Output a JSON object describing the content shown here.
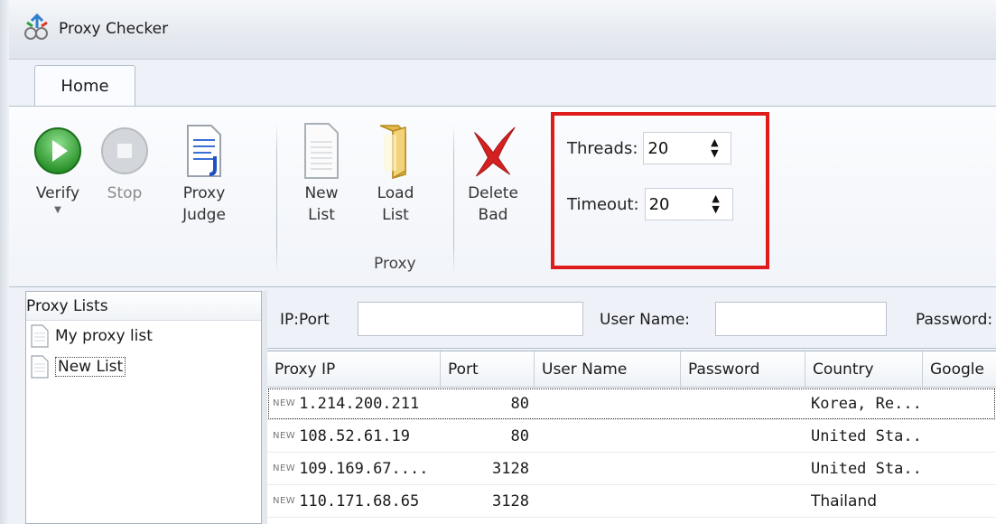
{
  "window": {
    "title": "Proxy Checker"
  },
  "ribbon": {
    "tab": "Home",
    "buttons": {
      "verify": "Verify",
      "stop": "Stop",
      "proxy_judge": "Proxy\nJudge",
      "new_list": "New\nList",
      "load_list": "Load\nList",
      "delete_bad": "Delete\nBad"
    },
    "group_proxy": "Proxy",
    "threads": {
      "label": "Threads:",
      "value": "20"
    },
    "timeout": {
      "label": "Timeout:",
      "value": "20"
    }
  },
  "proxy_lists": {
    "header": "Proxy Lists",
    "items": [
      {
        "name": "My proxy list",
        "selected": false
      },
      {
        "name": "New List",
        "selected": true
      }
    ]
  },
  "filter": {
    "ip_port_label": "IP:Port",
    "ip_port_value": "",
    "username_label": "User Name:",
    "username_value": "",
    "password_label": "Password:"
  },
  "grid": {
    "columns": [
      "Proxy IP",
      "Port",
      "User Name",
      "Password",
      "Country",
      "Google"
    ],
    "new_tag": "NEW",
    "rows": [
      {
        "ip": "1.214.200.211",
        "port": "80",
        "user": "",
        "password": "",
        "country": "Korea, Re..."
      },
      {
        "ip": "108.52.61.19",
        "port": "80",
        "user": "",
        "password": "",
        "country": "United Sta..."
      },
      {
        "ip": "109.169.67....",
        "port": "3128",
        "user": "",
        "password": "",
        "country": "United Sta..."
      },
      {
        "ip": "110.171.68.65",
        "port": "3128",
        "user": "",
        "password": "",
        "country": "Thailand"
      }
    ]
  },
  "colors": {
    "highlight_box": "#e01b1b",
    "verify_green": "#2e9e2e",
    "delete_red": "#d42020"
  }
}
